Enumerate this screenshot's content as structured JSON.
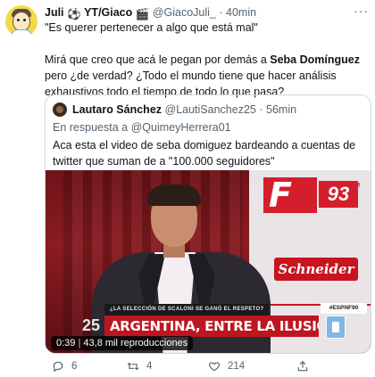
{
  "tweet": {
    "name": "Juli",
    "name_emoji": "⚽",
    "name_suffix": "YT/Giaco",
    "name_emoji2": "🎬",
    "handle": "@GiacoJuli_",
    "dot": "·",
    "time": "40min",
    "more": "···",
    "line1": "\"Es querer pertenecer a algo que está mal\"",
    "line2_a": "Mirá que creo que acá le pegan por demás a ",
    "line2_bold": "Seba Domínguez",
    "line2_b": " pero ¿de verdad? ¿Todo el mundo tiene que hacer análisis exhaustivos todo el tiempo de todo lo que pasa?"
  },
  "quote": {
    "name": "Lautaro Sánchez",
    "handle": "@LautiSanchez25",
    "dot": "·",
    "time": "56min",
    "reply_prefix": "En respuesta a",
    "reply_handle": "@QuimeyHerrera01",
    "text": "Aca esta el video de seba domiguez bardeando a cuentas de twitter que suman de a \"100.000 seguidores\"",
    "video": {
      "logo": "F",
      "logo_number": "93",
      "logo_fm": "FM",
      "sponsor": "Schneider",
      "lower_small": "¿LA SELECCIÓN DE SCALONI SE GANÓ EL RESPETO?",
      "lower_num": "25",
      "lower_headline": "ARGENTINA, ENTRE LA ILUSIÓN Y LA CORDURA",
      "hashtag": "#ESPNF90",
      "time": "0:39",
      "sep": "|",
      "views": "43,8 mil reproducciones"
    }
  },
  "actions": {
    "replies": "6",
    "retweets": "4",
    "likes": "214"
  },
  "colors": {
    "text": "#0f1419",
    "muted": "#536471",
    "border": "#cfd9de",
    "espn_red": "#bd1621"
  }
}
